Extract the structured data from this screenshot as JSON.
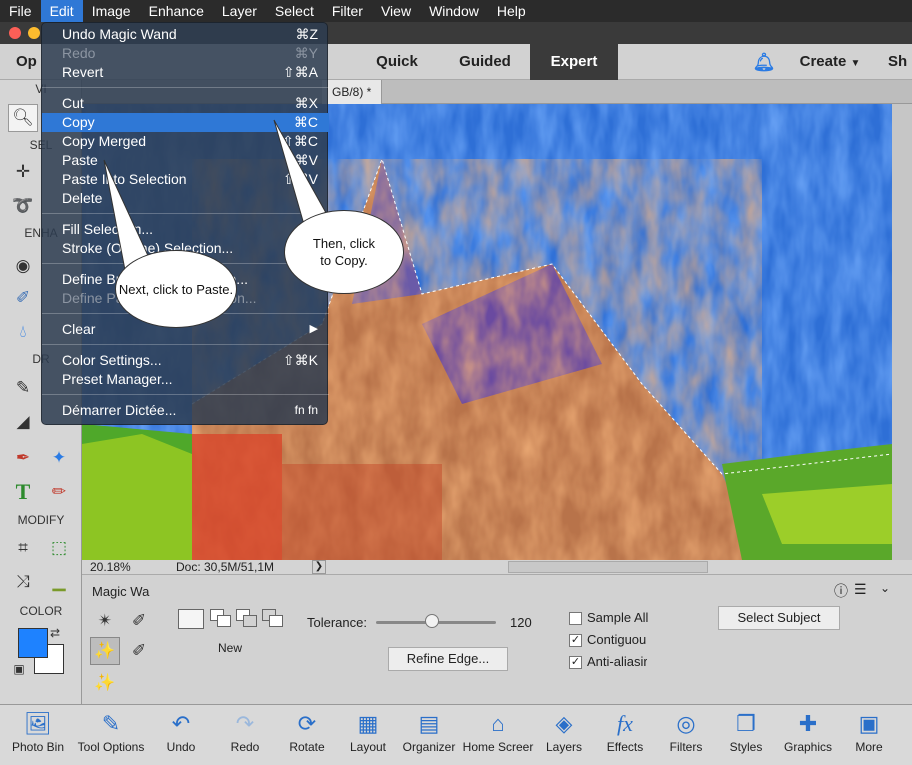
{
  "menubar": {
    "items": [
      "File",
      "Edit",
      "Image",
      "Enhance",
      "Layer",
      "Select",
      "Filter",
      "View",
      "Window",
      "Help"
    ]
  },
  "modes": {
    "open": "Op",
    "quick": "Quick",
    "guided": "Guided",
    "expert": "Expert",
    "create": "Create",
    "share": "Sh"
  },
  "edit_menu": {
    "undo": {
      "label": "Undo Magic Wand",
      "shortcut": "⌘Z"
    },
    "redo": {
      "label": "Redo",
      "shortcut": "⌘Y"
    },
    "revert": {
      "label": "Revert",
      "shortcut": "⇧⌘A"
    },
    "cut": {
      "label": "Cut",
      "shortcut": "⌘X"
    },
    "copy": {
      "label": "Copy",
      "shortcut": "⌘C"
    },
    "copy_merged": {
      "label": "Copy Merged",
      "shortcut": "⇧⌘C"
    },
    "paste": {
      "label": "Paste",
      "shortcut": "⌘V"
    },
    "paste_into": {
      "label": "Paste Into Selection",
      "shortcut": "⇧⌘V"
    },
    "delete": {
      "label": "Delete"
    },
    "fill": {
      "label": "Fill Selection..."
    },
    "stroke": {
      "label": "Stroke (Outline) Selection..."
    },
    "define_brush": {
      "label": "Define Brush from Selection..."
    },
    "define_pattern": {
      "label": "Define Pattern from Selection..."
    },
    "clear": {
      "label": "Clear"
    },
    "color_settings": {
      "label": "Color Settings...",
      "shortcut": "⇧⌘K"
    },
    "preset_manager": {
      "label": "Preset Manager..."
    },
    "dictation": {
      "label": "Démarrer Dictée...",
      "shortcut": "fn fn"
    }
  },
  "callouts": {
    "paste": "Next, click to Paste.",
    "copy": "Then, click to Copy."
  },
  "toolbox": {
    "view": "VI",
    "select": "SEL",
    "enhance": "ENHA",
    "draw": "DR",
    "modify": "MODIFY",
    "color": "COLOR",
    "fg_color": "#1e82ff",
    "bg_color": "#ffffff"
  },
  "document": {
    "tab_title": "GB/8) *",
    "zoom": "20.18%",
    "doc_size": "Doc: 30,5M/51,1M"
  },
  "tool_options": {
    "tool_name": "Magic Wa",
    "new_label": "New",
    "tolerance_label": "Tolerance:",
    "tolerance_value": "120",
    "tolerance_fraction": 0.47,
    "refine_edge": "Refine Edge...",
    "sample_all": "Sample All",
    "contiguous": "Contiguou",
    "anti_alias": "Anti-aliasir",
    "select_subject": "Select Subject"
  },
  "bottom_bar": {
    "items": [
      "Photo Bin",
      "Tool Options",
      "Undo",
      "Redo",
      "Rotate",
      "Layout",
      "Organizer",
      "Home Screer",
      "Layers",
      "Effects",
      "Filters",
      "Styles",
      "Graphics",
      "More"
    ]
  }
}
